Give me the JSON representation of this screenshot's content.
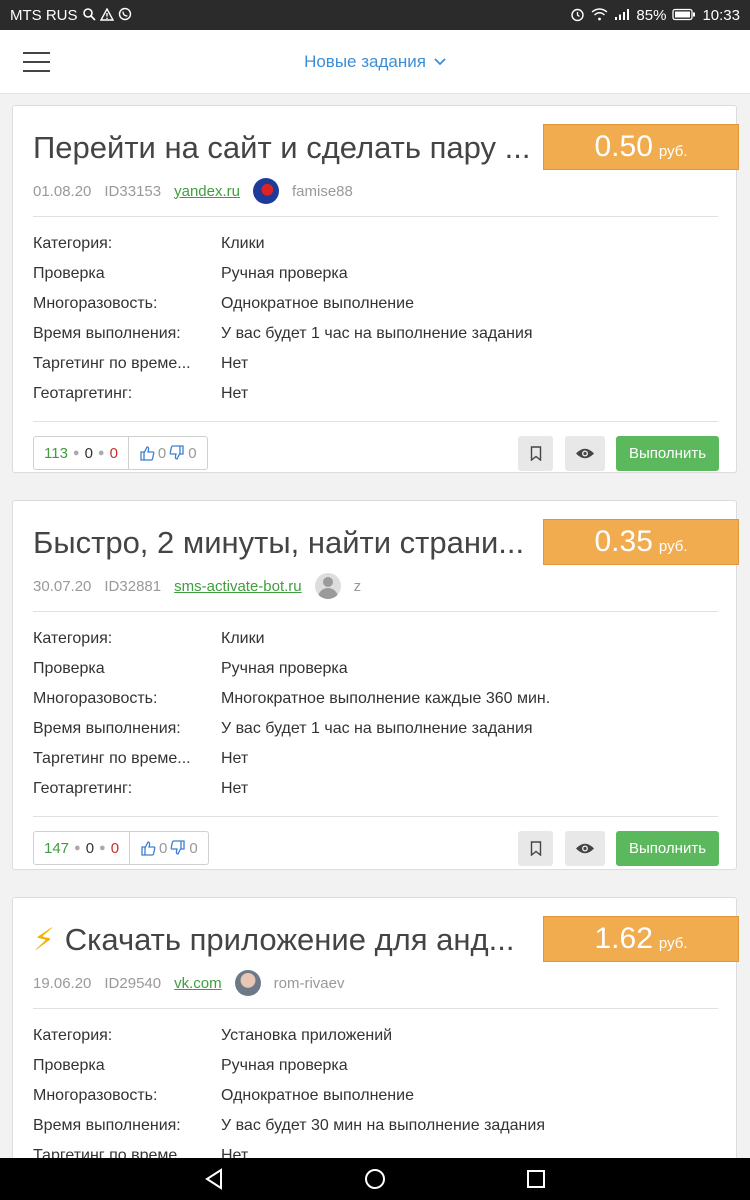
{
  "status_bar": {
    "carrier": "MTS RUS",
    "battery": "85%",
    "time": "10:33"
  },
  "header": {
    "title": "Новые задания"
  },
  "labels": {
    "category": "Категория:",
    "check": "Проверка",
    "repeat": "Многоразовость:",
    "time": "Время выполнения:",
    "targeting_time": "Таргетинг по време...",
    "geo": "Геотаргетинг:",
    "run_button": "Выполнить"
  },
  "tasks": [
    {
      "title": "Перейти на сайт и сделать пару ...",
      "price": "0.50",
      "currency": "руб.",
      "date": "01.08.20",
      "id": "ID33153",
      "domain": "yandex.ru",
      "author": "famise88",
      "category": "Клики",
      "check": "Ручная проверка",
      "repeat": "Однократное выполнение",
      "time": "У вас будет 1 час на выполнение задания",
      "targeting_time": "Нет",
      "geo": "Нет",
      "stats": {
        "done": "113",
        "pending": "0",
        "rejected": "0",
        "likes": "0",
        "dislikes": "0"
      }
    },
    {
      "title": "Быстро, 2 минуты, найти страни...",
      "price": "0.35",
      "currency": "руб.",
      "date": "30.07.20",
      "id": "ID32881",
      "domain": "sms-activate-bot.ru",
      "author": "z",
      "category": "Клики",
      "check": "Ручная проверка",
      "repeat": "Многократное выполнение каждые 360 мин.",
      "time": "У вас будет 1 час на выполнение задания",
      "targeting_time": "Нет",
      "geo": "Нет",
      "stats": {
        "done": "147",
        "pending": "0",
        "rejected": "0",
        "likes": "0",
        "dislikes": "0"
      }
    },
    {
      "title": "Скачать приложение для анд...",
      "title_icon": "⚡",
      "price": "1.62",
      "currency": "руб.",
      "date": "19.06.20",
      "id": "ID29540",
      "domain": "vk.com",
      "author": "rom-rivaev",
      "category": "Установка приложений",
      "check": "Ручная проверка",
      "repeat": "Однократное выполнение",
      "time": "У вас будет 30 мин на выполнение задания",
      "targeting_time": "Нет"
    }
  ],
  "colors": {
    "accent": "#3b8ed6",
    "price": "#f0ac4e",
    "run": "#5cb85c",
    "domain": "#3f9d3f"
  }
}
